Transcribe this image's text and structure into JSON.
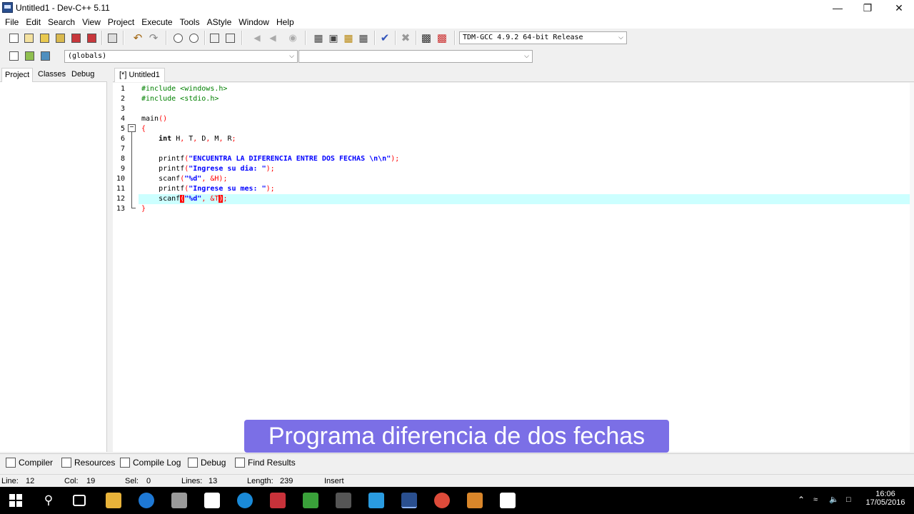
{
  "window": {
    "title": "Untitled1 - Dev-C++ 5.11"
  },
  "menu": [
    "File",
    "Edit",
    "Search",
    "View",
    "Project",
    "Execute",
    "Tools",
    "AStyle",
    "Window",
    "Help"
  ],
  "toolbar": {
    "compiler_select": "TDM-GCC 4.9.2 64-bit Release",
    "scope_select": "(globals)",
    "symbol_select": ""
  },
  "left_panel": {
    "tabs": [
      "Project",
      "Classes",
      "Debug"
    ],
    "active_tab": "Project"
  },
  "editor": {
    "tab_label": "[*] Untitled1",
    "line_numbers": [
      "1",
      "2",
      "3",
      "4",
      "5",
      "6",
      "7",
      "8",
      "9",
      "10",
      "11",
      "12",
      "13"
    ],
    "code": {
      "l1": "#include <windows.h>",
      "l2": "#include <stdio.h>",
      "l4a": "main",
      "l4b": "()",
      "l5": "{",
      "l6a": "int",
      "l6b": "H",
      "l6c": "T",
      "l6d": "D",
      "l6e": "M",
      "l6f": "R",
      "l8a": "printf",
      "l8b": "\"ENCUENTRA LA DIFERENCIA ENTRE DOS FECHAS \\n\\n\"",
      "l9a": "printf",
      "l9b": "\"Ingrese su dia: \"",
      "l10a": "scanf",
      "l10b": "\"%d\"",
      "l10c": "&H",
      "l11a": "printf",
      "l11b": "\"Ingrese su mes: \"",
      "l12a": "scanf",
      "l12b": "\"%d\"",
      "l12c": "&T",
      "l13": "}"
    }
  },
  "caption": "Programa diferencia de dos fechas",
  "bottom_tabs": [
    "Compiler",
    "Resources",
    "Compile Log",
    "Debug",
    "Find Results"
  ],
  "status": {
    "line_label": "Line:",
    "line_value": "12",
    "col_label": "Col:",
    "col_value": "19",
    "sel_label": "Sel:",
    "sel_value": "0",
    "lines_label": "Lines:",
    "lines_value": "13",
    "length_label": "Length:",
    "length_value": "239",
    "mode": "Insert"
  },
  "taskbar": {
    "time": "16:06",
    "date": "17/05/2016"
  },
  "colors": {
    "caption_bg": "#7b6fe6",
    "current_line": "#ccffff",
    "preprocessor": "#008000",
    "string": "#0000ff",
    "symbol": "#ff0000"
  }
}
